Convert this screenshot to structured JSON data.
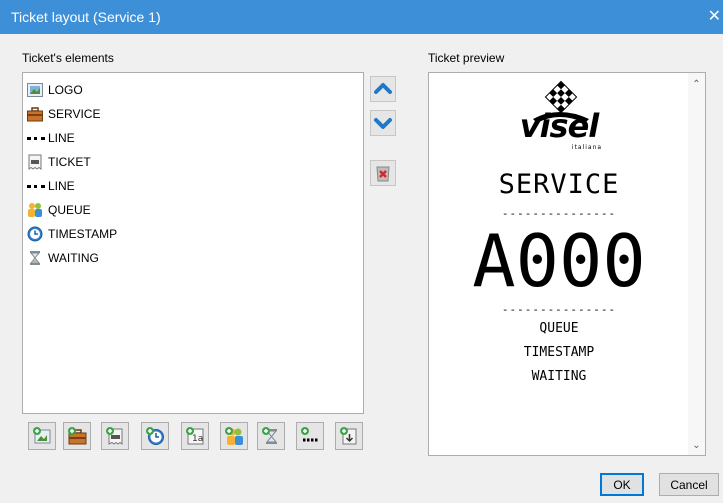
{
  "window": {
    "title": "Ticket layout (Service 1)",
    "close_glyph": "✕"
  },
  "labels": {
    "elements": "Ticket's elements",
    "preview": "Ticket preview"
  },
  "elements": [
    {
      "label": "LOGO",
      "icon": "image-icon"
    },
    {
      "label": "SERVICE",
      "icon": "briefcase-icon"
    },
    {
      "label": "LINE",
      "icon": "line-icon"
    },
    {
      "label": "TICKET",
      "icon": "ticket-icon"
    },
    {
      "label": "LINE",
      "icon": "line-icon"
    },
    {
      "label": "QUEUE",
      "icon": "people-icon"
    },
    {
      "label": "TIMESTAMP",
      "icon": "clock-icon"
    },
    {
      "label": "WAITING",
      "icon": "hourglass-icon"
    }
  ],
  "side_buttons": [
    "move-up-icon",
    "move-down-icon",
    "delete-icon"
  ],
  "bottom_buttons": [
    "add-logo-icon",
    "add-service-icon",
    "add-ticket-icon",
    "add-timestamp-icon",
    "add-text-icon",
    "add-queue-icon",
    "add-waiting-icon",
    "add-line-icon",
    "add-cut-icon"
  ],
  "preview": {
    "logo_text": "visel",
    "logo_sub": "italiana",
    "service": "SERVICE",
    "dashes": "---------------",
    "ticket": "A000",
    "queue": "QUEUE",
    "timestamp": "TIMESTAMP",
    "waiting": "WAITING"
  },
  "buttons": {
    "ok": "OK",
    "cancel": "Cancel"
  },
  "colors": {
    "titlebar": "#3d8fd8",
    "arrow": "#1f79c7",
    "delete": "#d9262a"
  }
}
